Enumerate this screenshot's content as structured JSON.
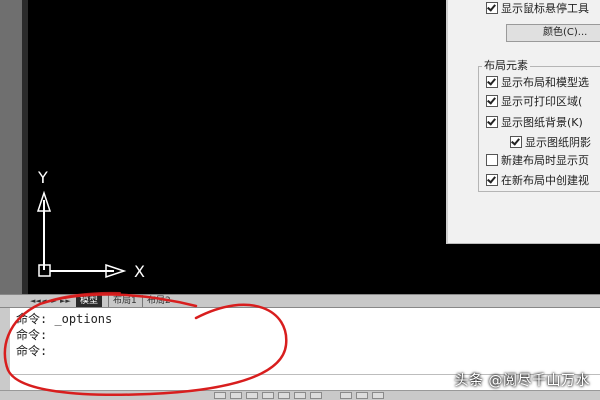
{
  "options_dialog": {
    "show_rollover_toolbar_label": "显示鼠标悬停工具",
    "color_button_label": "颜色(C)...",
    "layout_elements_group_title": "布局元素",
    "layout_items": [
      {
        "label": "显示布局和模型选",
        "checked": true
      },
      {
        "label": "显示可打印区域(",
        "checked": true
      },
      {
        "label": "显示图纸背景(K)",
        "checked": true
      },
      {
        "label": "显示图纸阴影",
        "checked": true
      },
      {
        "label": "新建布局时显示页",
        "checked": false
      },
      {
        "label": "在新布局中创建视",
        "checked": true
      }
    ]
  },
  "ucs": {
    "y_label": "Y",
    "x_label": "X"
  },
  "tabs": {
    "nav": [
      "◄◄",
      "◄",
      "►",
      "►►"
    ],
    "items": [
      "模型",
      "布局1",
      "布局2"
    ]
  },
  "command_window": {
    "lines": [
      "命令: _options",
      "命令:",
      "命令:"
    ]
  },
  "watermark": "头条 @阅尽千山万水",
  "colors": {
    "canvas": "#000000",
    "annotation": "#d81e1e",
    "dialog_bg": "#f1f1f1",
    "command_bg": "#ffffff"
  }
}
